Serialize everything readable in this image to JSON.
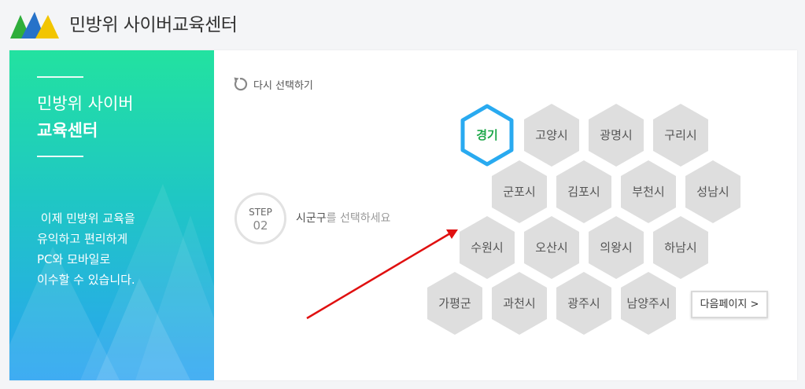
{
  "header": {
    "title": "민방위 사이버교육센터"
  },
  "sidebar": {
    "title_line1": "민방위 사이버",
    "title_line2": "교육센터",
    "description": [
      " 이제 민방위 교육을",
      "유익하고 편리하게",
      "PC와 모바일로",
      "이수할 수 있습니다."
    ]
  },
  "reset": {
    "label": "다시 선택하기",
    "icon": "refresh-icon"
  },
  "step": {
    "label": "STEP",
    "number": "02",
    "instruction_strong": "시군구",
    "instruction_rest": "를 선택하세요"
  },
  "regions": [
    {
      "name": "경기",
      "selected": true
    },
    {
      "name": "고양시"
    },
    {
      "name": "광명시"
    },
    {
      "name": "구리시"
    },
    {
      "name": "군포시"
    },
    {
      "name": "김포시"
    },
    {
      "name": "부천시"
    },
    {
      "name": "성남시"
    },
    {
      "name": "수원시"
    },
    {
      "name": "오산시"
    },
    {
      "name": "의왕시"
    },
    {
      "name": "하남시"
    },
    {
      "name": "가평군"
    },
    {
      "name": "과천시"
    },
    {
      "name": "광주시"
    },
    {
      "name": "남양주시"
    }
  ],
  "next_button": {
    "label": "다음페이지 >"
  },
  "colors": {
    "selected_border": "#29aaf0",
    "selected_text": "#1ea84a",
    "hex_fill": "#dedede",
    "arrow": "#e01010",
    "sidebar_gradient": [
      "#22e2a0",
      "#2aa3f2"
    ]
  }
}
